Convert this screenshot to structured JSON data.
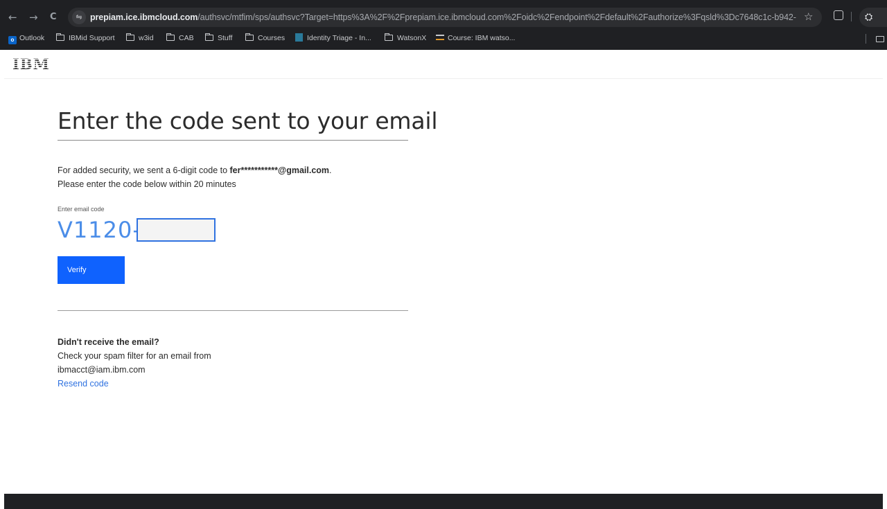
{
  "browser": {
    "url_host": "prepiam.ice.ibmcloud.com",
    "url_path": "/authsvc/mtfim/sps/authsvc?Target=https%3A%2F%2Fprepiam.ice.ibmcloud.com%2Foidc%2Fendpoint%2Fdefault%2Fauthorize%3Fqsld%3Dc7648c1c-b942-...",
    "nav": {
      "back": "←",
      "forward": "→",
      "reload": "C"
    },
    "bookmarks": [
      {
        "label": "Outlook",
        "icon": "outlook-icon"
      },
      {
        "label": "IBMid Support",
        "icon": "folder-icon"
      },
      {
        "label": "w3id",
        "icon": "folder-icon"
      },
      {
        "label": "CAB",
        "icon": "folder-icon"
      },
      {
        "label": "Stuff",
        "icon": "folder-icon"
      },
      {
        "label": "Courses",
        "icon": "folder-icon"
      },
      {
        "label": "Identity Triage - In...",
        "icon": "document-icon"
      },
      {
        "label": "WatsonX",
        "icon": "folder-icon"
      },
      {
        "label": "Course: IBM watso...",
        "icon": "course-icon"
      }
    ]
  },
  "header": {
    "logo": "IBM"
  },
  "main": {
    "title": "Enter the code sent to your email",
    "desc_prefix": "For added security, we sent a 6-digit code to ",
    "email": "fer***********@gmail.com",
    "desc_suffix": ".",
    "desc_line2": "Please enter the code below within 20 minutes",
    "code_label": "Enter email code",
    "code_prefix": "V1120-",
    "code_value": "",
    "verify_label": "Verify"
  },
  "help": {
    "title": "Didn't receive the email?",
    "line1": "Check your spam filter for an email from",
    "line2": "ibmacct@iam.ibm.com",
    "resend_label": "Resend code"
  },
  "colors": {
    "primary_button": "#0f62fe",
    "link": "#2f72e0",
    "code_prefix": "#4b8de8",
    "chrome": "#1f2023"
  }
}
